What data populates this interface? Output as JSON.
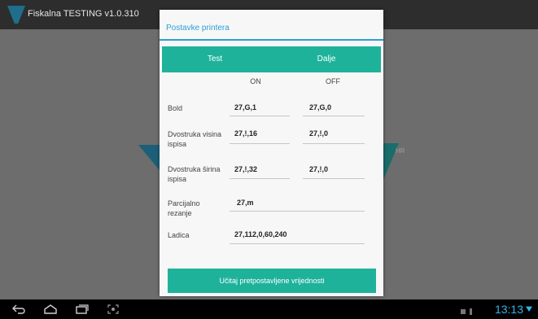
{
  "app": {
    "title": "Fiskalna TESTING v1.0.310"
  },
  "background": {
    "hr_label": "HR"
  },
  "dialog": {
    "title": "Postavke printera",
    "tabs": [
      "Test",
      "Dalje"
    ],
    "column_headers": [
      "ON",
      "OFF"
    ],
    "rows": [
      {
        "label": "Bold",
        "on": "27,G,1",
        "off": "27,G,0"
      },
      {
        "label": "Dvostruka visina ispisa",
        "on": "27,!,16",
        "off": "27,!,0"
      },
      {
        "label": "Dvostruka širina ispisa",
        "on": "27,!,32",
        "off": "27,!,0"
      },
      {
        "label": "Parcijalno rezanje",
        "value": "27,m"
      },
      {
        "label": "Ladica",
        "value": "27,112,0,60,240"
      }
    ],
    "load_defaults_label": "Učitaj pretpostavljene vrijednosti"
  },
  "status_bar": {
    "time": "13:13"
  },
  "colors": {
    "accent": "#1fb29b",
    "title_blue": "#2a9fd6",
    "clock": "#33b5e5"
  },
  "icons": [
    "app-logo-icon",
    "back-icon",
    "home-icon",
    "recent-apps-icon",
    "screenshot-icon",
    "wifi-icon"
  ]
}
